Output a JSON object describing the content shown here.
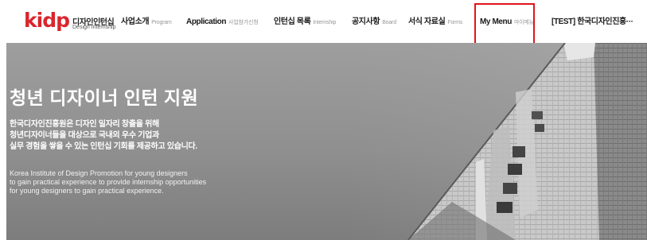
{
  "logo": {
    "mark": "kidp",
    "title": "디자인인턴십",
    "subtitle": "Design Internship"
  },
  "nav": [
    {
      "main": "사업소개",
      "sub": "Program"
    },
    {
      "main": "Application",
      "sub": "사업참가신청"
    },
    {
      "main": "인턴십 목록",
      "sub": "Internship"
    },
    {
      "main": "공지사항",
      "sub": "Board"
    },
    {
      "main": "서식 자료실",
      "sub": "Forms"
    },
    {
      "main": "My Menu",
      "sub": "마이메뉴"
    },
    {
      "main": "[TEST] 한국디자인진흥···",
      "sub": ""
    }
  ],
  "hero": {
    "title": "청년 디자이너 인턴 지원",
    "ko_lines": [
      "한국디자인진흥원은 디자인 일자리 창출을 위해",
      "청년디자이너들을 대상으로 국내외 우수 기업과",
      "실무 경험을 쌓을 수 있는 인턴십 기회를 제공하고 있습니다."
    ],
    "en_lines": [
      "Korea Institute of Design Promotion for young designers",
      "to gain practical experience to provide internship opportunities",
      "for young designers to gain practical experience."
    ]
  },
  "colors": {
    "brand": "#d9262d",
    "highlight": "#e0141c",
    "hero_bg": "#8f8f8f"
  }
}
